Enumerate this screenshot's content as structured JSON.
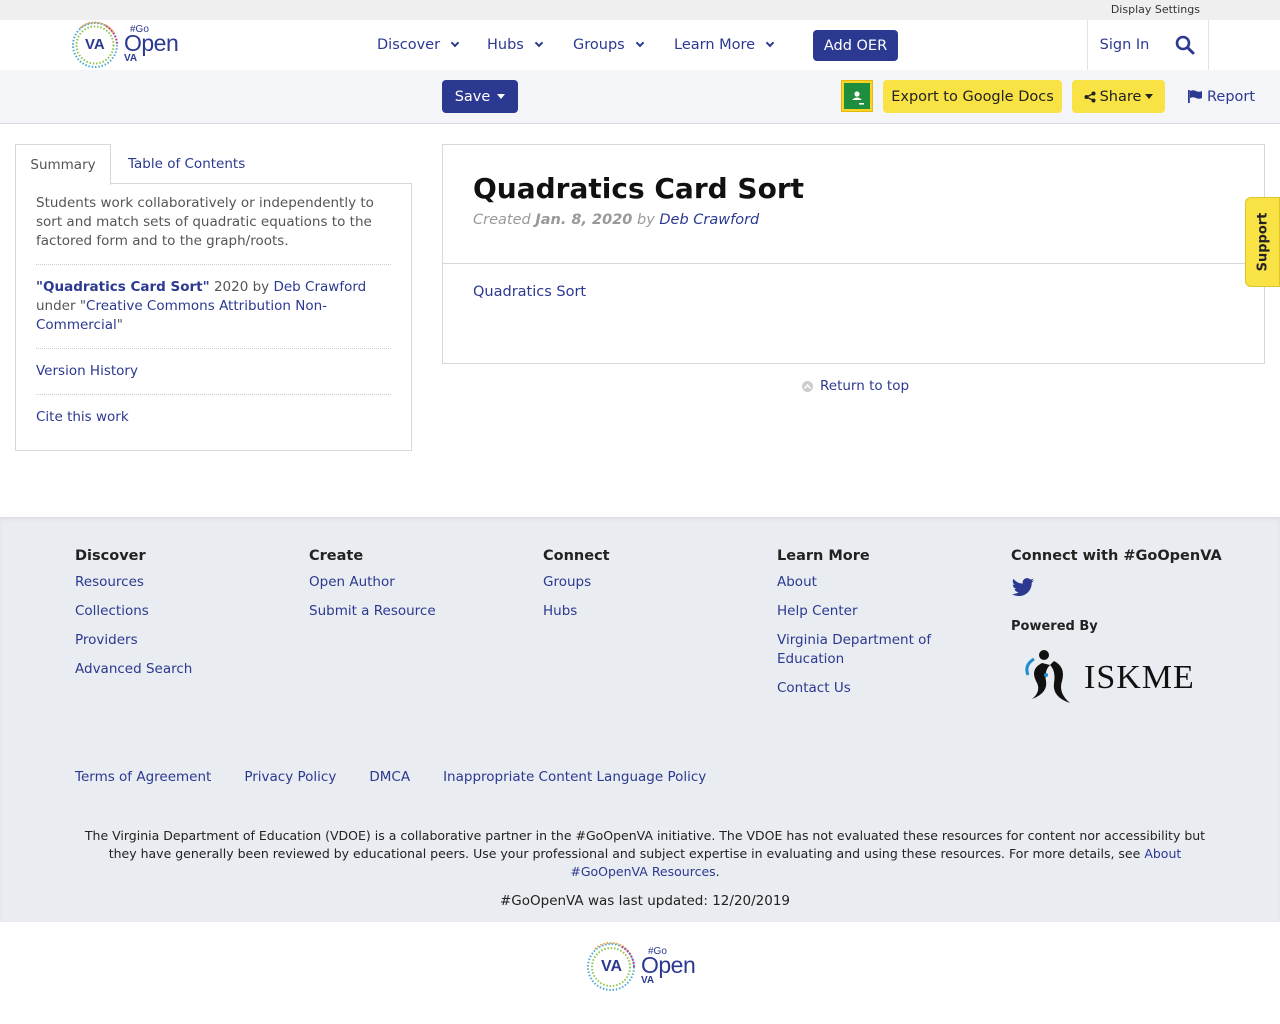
{
  "topbar": {
    "display_settings": "Display Settings"
  },
  "header": {
    "logo_top": "#Go",
    "logo_main": "Open",
    "logo_va": "VA",
    "nav": [
      {
        "label": "Discover"
      },
      {
        "label": "Hubs"
      },
      {
        "label": "Groups"
      },
      {
        "label": "Learn More"
      }
    ],
    "add_oer": "Add OER",
    "sign_in": "Sign In",
    "search_icon": "search-icon"
  },
  "toolbar": {
    "save": "Save",
    "export": "Export to Google Docs",
    "share": "Share",
    "report": "Report"
  },
  "sidebar": {
    "tabs": {
      "summary": "Summary",
      "toc": "Table of Contents"
    },
    "summary_text": "Students work collaboratively or independently to sort and match sets of quadratic equations to the factored form and to the graph/roots.",
    "attribution": {
      "title": "\"Quadratics Card Sort\"",
      "year_by": "2020 by",
      "author": "Deb Crawford",
      "under": "under \"",
      "license": "Creative Commons Attribution Non-Commercial",
      "close": "\""
    },
    "version_history": "Version History",
    "cite": "Cite this work"
  },
  "resource": {
    "title": "Quadratics Card Sort",
    "created_label": "Created",
    "date": "Jan. 8, 2020",
    "by": "by",
    "author": "Deb Crawford",
    "link": "Quadratics Sort",
    "return_top": "Return to top"
  },
  "support": "Support",
  "footer": {
    "discover": {
      "title": "Discover",
      "links": [
        "Resources",
        "Collections",
        "Providers",
        "Advanced Search"
      ]
    },
    "create": {
      "title": "Create",
      "links": [
        "Open Author",
        "Submit a Resource"
      ]
    },
    "connect": {
      "title": "Connect",
      "links": [
        "Groups",
        "Hubs"
      ]
    },
    "learn": {
      "title": "Learn More",
      "links": [
        "About",
        "Help Center",
        "Virginia Department of Education",
        "Contact Us"
      ]
    },
    "social_title": "Connect with #GoOpenVA",
    "powered_by": "Powered By",
    "iskme": "ISKME",
    "legal": [
      "Terms of Agreement",
      "Privacy Policy",
      "DMCA",
      "Inappropriate Content Language Policy"
    ],
    "disclaimer": "The Virginia Department of Education (VDOE) is a collaborative partner in the #GoOpenVA initiative. The VDOE has not evaluated these resources for content nor accessibility but they have generally been reviewed by educational peers. Use your professional and subject expertise in evaluating and using these resources. For more details, see",
    "disclaimer_link": "About #GoOpenVA Resources",
    "disclaimer_end": ".",
    "updated": "#GoOpenVA was last updated: 12/20/2019"
  },
  "colors": {
    "brand": "#2b3990",
    "accent_yellow": "#f9e244"
  }
}
